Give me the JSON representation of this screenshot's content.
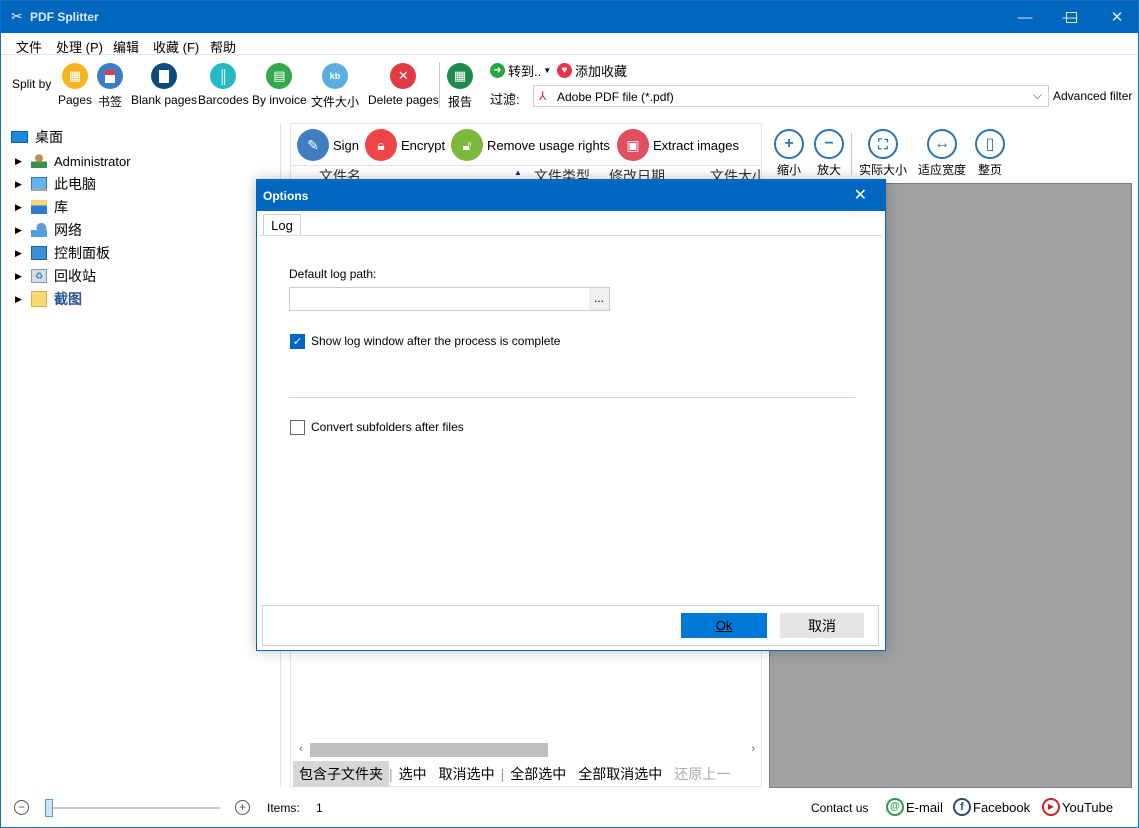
{
  "app": {
    "title": "PDF Splitter",
    "icon": "scissors-icon"
  },
  "window_controls": {
    "minimize": "—",
    "maximize": "☐",
    "close": "✕"
  },
  "menu": [
    "文件",
    "处理 (P)",
    "编辑",
    "收藏 (F)",
    "帮助"
  ],
  "toolbar": {
    "split_by_label": "Split by",
    "split_buttons": [
      {
        "label": "Pages",
        "icon": "grid-icon",
        "color": "#f5b522"
      },
      {
        "label": "书签",
        "icon": "bookmark-icon",
        "color": "#3b7dc4"
      },
      {
        "label": "Blank pages",
        "icon": "blank-page-icon",
        "color": "#0e4a7d"
      },
      {
        "label": "Barcodes",
        "icon": "barcode-icon",
        "color": "#24b9c4"
      },
      {
        "label": "By invoice",
        "icon": "invoice-icon",
        "color": "#35a84a"
      },
      {
        "label": "文件大小",
        "icon": "kb-icon",
        "color": "#5aaee0"
      },
      {
        "label": "Delete pages",
        "icon": "delete-page-icon",
        "color": "#e13b45"
      }
    ],
    "report": {
      "label": "报告",
      "icon": "report-icon",
      "color": "#1f8b4c"
    },
    "goto": {
      "label": "转到..",
      "icon": "arrow-right-icon"
    },
    "favorite": {
      "label": "添加收藏",
      "icon": "heart-icon"
    },
    "filter_label": "过滤:",
    "filter_value": "Adobe PDF file (*.pdf)",
    "advanced_filter": "Advanced filter"
  },
  "tree": {
    "root": "桌面",
    "items": [
      {
        "label": "Administrator",
        "icon": "user-icon"
      },
      {
        "label": "此电脑",
        "icon": "computer-icon"
      },
      {
        "label": "库",
        "icon": "library-icon"
      },
      {
        "label": "网络",
        "icon": "network-icon"
      },
      {
        "label": "控制面板",
        "icon": "control-panel-icon"
      },
      {
        "label": "回收站",
        "icon": "recycle-bin-icon"
      },
      {
        "label": "截图",
        "icon": "folder-icon"
      }
    ]
  },
  "actions": [
    {
      "label": "Sign",
      "icon": "pen-icon",
      "color": "#3f7fc1"
    },
    {
      "label": "Encrypt",
      "icon": "lock-icon",
      "color": "#ef4545"
    },
    {
      "label": "Remove usage rights",
      "icon": "unlock-icon",
      "color": "#7ab93a"
    },
    {
      "label": "Extract images",
      "icon": "image-icon",
      "color": "#e04f5f"
    }
  ],
  "columns": [
    "文件名",
    "文件类型",
    "修改日期",
    "文件大小"
  ],
  "zoom_tools": [
    {
      "label": "缩小",
      "icon": "plus-icon",
      "glyph": "+"
    },
    {
      "label": "放大",
      "icon": "minus-icon",
      "glyph": "−"
    },
    {
      "label": "实际大小",
      "icon": "actual-size-icon",
      "glyph": "⛶"
    },
    {
      "label": "适应宽度",
      "icon": "fit-width-icon",
      "glyph": "↔"
    },
    {
      "label": "整页",
      "icon": "page-icon",
      "glyph": "▯"
    }
  ],
  "bottom_actions": [
    "包含子文件夹",
    "选中",
    "取消选中",
    "全部选中",
    "全部取消选中",
    "还原上一"
  ],
  "status": {
    "items_label": "Items:",
    "items_count": "1",
    "zoom_slider_value": 0,
    "contact": "Contact us",
    "email": "E-mail",
    "facebook": "Facebook",
    "youtube": "YouTube"
  },
  "dialog": {
    "title": "Options",
    "tab": "Log",
    "log_path_label": "Default log path:",
    "log_path_value": "",
    "browse": "...",
    "show_log": {
      "label": "Show log window after the process is complete",
      "checked": true
    },
    "convert_subfolders": {
      "label": "Convert subfolders after files",
      "checked": false
    },
    "ok": "Ok",
    "cancel": "取消"
  }
}
